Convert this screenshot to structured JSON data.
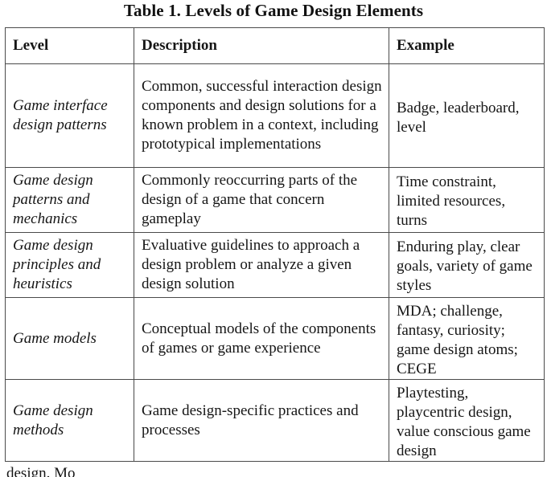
{
  "caption": "Table 1. Levels of Game Design Elements",
  "table": {
    "columns": [
      "Level",
      "Description",
      "Example"
    ],
    "rows": [
      {
        "level": "Game interface design patterns",
        "description": "Common, successful interaction design components and design solutions for a known problem in a context, including prototypical implementations",
        "example": "Badge, leaderboard, level"
      },
      {
        "level": "Game design patterns and mechanics",
        "description": "Commonly reoccurring parts of the design of a game that concern gameplay",
        "example": "Time constraint, limited resources, turns"
      },
      {
        "level": "Game design principles and heuristics",
        "description": "Evaluative guidelines to approach a design problem or analyze a given design solution",
        "example": "Enduring play, clear goals, variety of game styles"
      },
      {
        "level": "Game models",
        "description": "Conceptual models of the components of games or game experience",
        "example": "MDA; challenge, fantasy, curiosity; game design atoms; CEGE"
      },
      {
        "level": "Game design methods",
        "description": "Game design-specific practices and processes",
        "example": "Playtesting, playcentric design, value conscious game design"
      }
    ]
  },
  "after_table_text": "design. Mo"
}
